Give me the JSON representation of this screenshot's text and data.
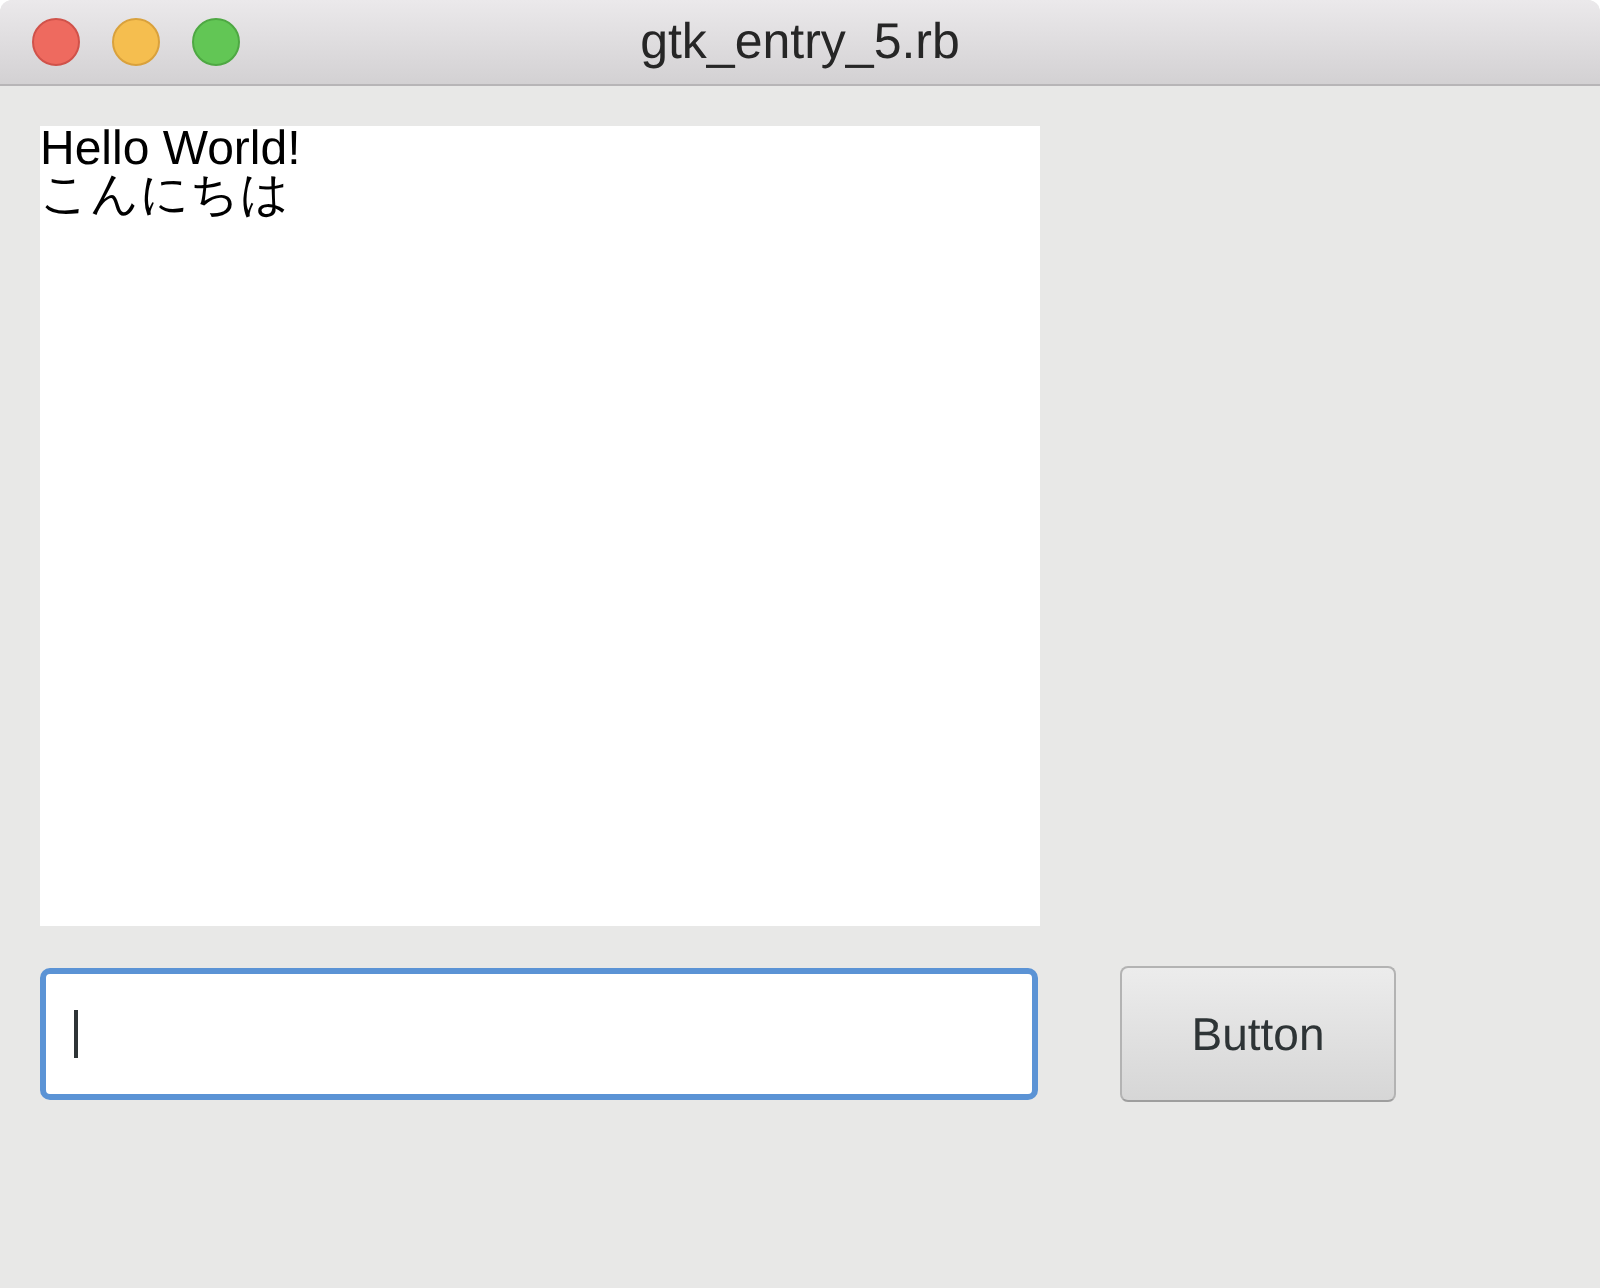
{
  "window": {
    "title": "gtk_entry_5.rb"
  },
  "text_view": {
    "lines": [
      "Hello World!",
      "こんにちは"
    ]
  },
  "entry": {
    "focused": true
  },
  "button": {
    "label": "Button"
  }
}
